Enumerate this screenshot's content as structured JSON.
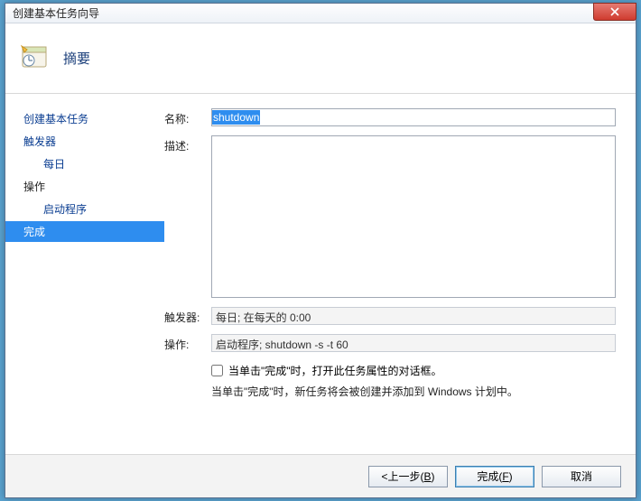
{
  "window": {
    "title": "创建基本任务向导"
  },
  "header": {
    "title": "摘要"
  },
  "sidebar": {
    "items": [
      {
        "label": "创建基本任务",
        "kind": "link"
      },
      {
        "label": "触发器",
        "kind": "link"
      },
      {
        "label": "每日",
        "kind": "sub"
      },
      {
        "label": "操作",
        "kind": "plain"
      },
      {
        "label": "启动程序",
        "kind": "sub"
      },
      {
        "label": "完成",
        "kind": "selected"
      }
    ]
  },
  "form": {
    "name_label": "名称:",
    "name_value": "shutdown",
    "desc_label": "描述:",
    "desc_value": "",
    "trigger_label": "触发器:",
    "trigger_value": "每日; 在每天的 0:00",
    "action_label": "操作:",
    "action_value": "启动程序; shutdown -s -t 60",
    "checkbox_label": "当单击\"完成\"时，打开此任务属性的对话框。",
    "hint": "当单击\"完成\"时，新任务将会被创建并添加到 Windows 计划中。"
  },
  "footer": {
    "back": "<上一步(",
    "back_key": "B",
    "back_tail": ")",
    "finish": "完成(",
    "finish_key": "F",
    "finish_tail": ")",
    "cancel": "取消"
  }
}
